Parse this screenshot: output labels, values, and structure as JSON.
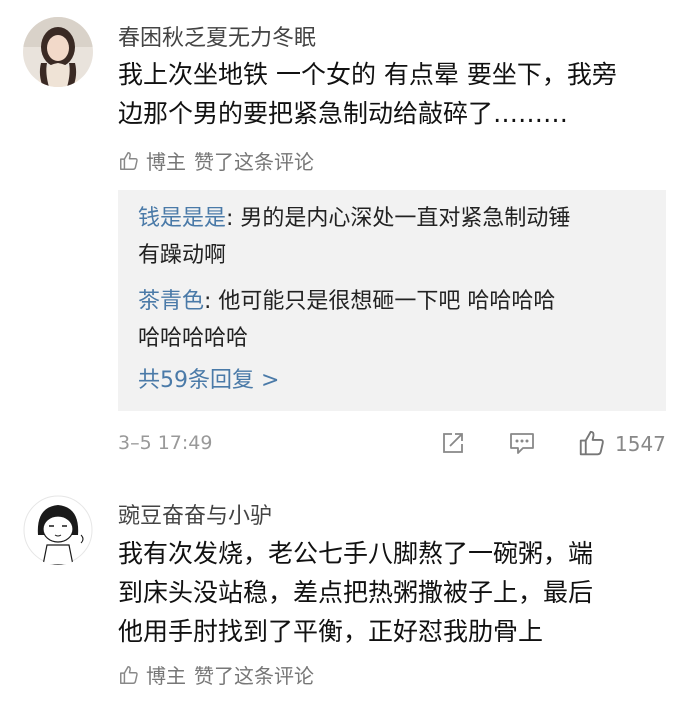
{
  "comments": [
    {
      "username": "春困秋乏夏无力冬眠",
      "text_lines": [
        "我上次坐地铁 一个女的 有点晕 要坐下，我旁",
        "边那个男的要把紧急制动给敲碎了………"
      ],
      "author_like": {
        "tag": "博主",
        "label": "赞了这条评论"
      },
      "replies": [
        {
          "name": "钱是是是",
          "sep": ": ",
          "lines": [
            "男的是内心深处一直对紧急制动锤",
            "有躁动啊"
          ]
        },
        {
          "name": "茶青色",
          "sep": ": ",
          "lines": [
            "他可能只是很想砸一下吧 哈哈哈哈",
            "哈哈哈哈哈"
          ]
        }
      ],
      "more_replies": "共59条回复 >",
      "timestamp": "3–5 17:49",
      "like_count": "1547",
      "icons": [
        "share-icon",
        "comment-icon",
        "like-icon"
      ]
    },
    {
      "username": "豌豆奋奋与小驴",
      "text_lines": [
        "我有次发烧，老公七手八脚熬了一碗粥，端",
        "到床头没站稳，差点把热粥撒被子上，最后",
        "他用手肘找到了平衡，正好怼我肋骨上"
      ],
      "author_like": {
        "tag": "博主",
        "label": "赞了这条评论"
      }
    }
  ],
  "colors": {
    "link": "#4a7aa8",
    "reply_bg": "#f2f2f2",
    "muted": "#999999"
  }
}
